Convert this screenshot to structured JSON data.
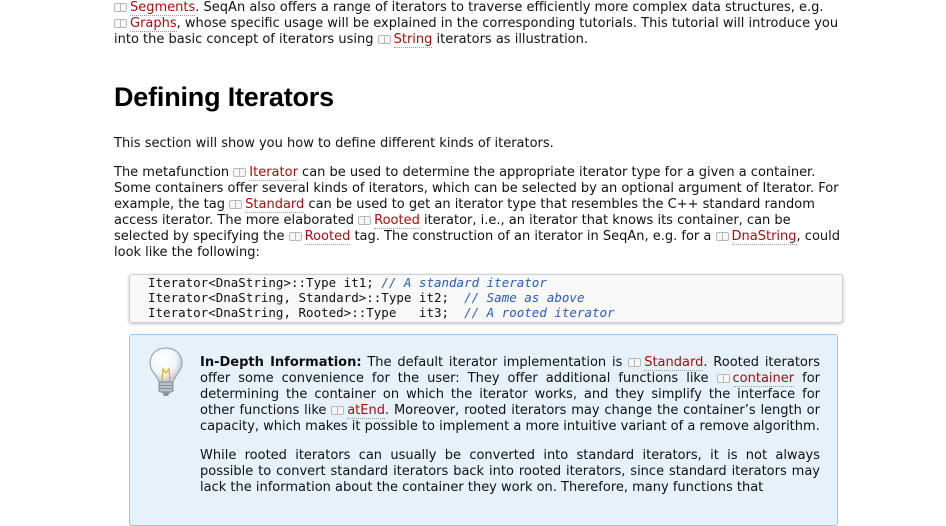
{
  "intro": {
    "seg1": "Segments",
    "t1": ". SeqAn also offers a range of iterators to traverse efficiently more complex data structures, e.g. ",
    "seg2": "Graphs",
    "t2": ", whose specific usage will be explained in the corresponding tutorials. This tutorial will introduce you into the basic concept of iterators using ",
    "seg3": "String",
    "t3": " iterators as illustration."
  },
  "heading": "Defining Iterators",
  "section_intro": "This section will show you how to define different kinds of iterators.",
  "para": {
    "t1": "The metafunction ",
    "l1": "Iterator",
    "t2": " can be used to determine the appropriate iterator type for a given a container. Some containers offer several kinds of iterators, which can be selected by an optional argument of Iterator. For example, the tag ",
    "l2": "Standard",
    "t3": " can be used to get an iterator type that resembles the C++ standard random access iterator. The more elaborated ",
    "l3": "Rooted",
    "t4": " iterator, i.e., an iterator that knows its container, can be selected by specifying the ",
    "l4": "Rooted",
    "t5": " tag. The construction of an iterator in SeqAn, e.g. for a ",
    "l5": "DnaString",
    "t6": ", could look like the following:"
  },
  "code": [
    {
      "code": "Iterator<DnaString>::Type it1; ",
      "comment": "// A standard iterator"
    },
    {
      "code": "Iterator<DnaString, Standard>::Type it2;  ",
      "comment": "// Same as above"
    },
    {
      "code": "Iterator<DnaString, Rooted>::Type   it3;  ",
      "comment": "// A rooted iterator"
    }
  ],
  "info": {
    "icon": "lightbulb-icon",
    "label": "In-Depth Information:",
    "t1": " The default iterator implementation is ",
    "l1": "Standard",
    "t2": ". Rooted iterators offer some convenience for the user: They offer additional functions like ",
    "l2": "container",
    "t3": " for determining the container on which the iterator works, and they simplify the interface for other functions like ",
    "l3": "atEnd",
    "t4": ". Moreover, rooted iterators may change the container’s length or capacity, which makes it possible to implement a more intuitive variant of a remove algorithm.",
    "p2": "While rooted iterators can usually be converted into standard iterators, it is not always possible to convert standard iterators back into rooted iterators, since standard iterators may lack the information about the container they work on. Therefore, many functions that"
  },
  "colors": {
    "link": "#a01010",
    "comment": "#2a5db0",
    "infobox_bg": "#e6f1fa",
    "infobox_border": "#9cc4e4"
  }
}
